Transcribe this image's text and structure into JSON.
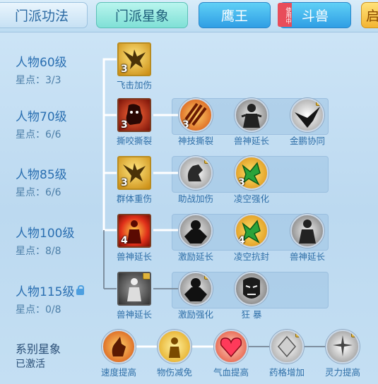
{
  "tabs": [
    {
      "label": "门派功法",
      "style": "plain"
    },
    {
      "label": "门派星象",
      "style": "active"
    },
    {
      "label": "鹰王",
      "style": "blue",
      "ribbon": "使用中"
    },
    {
      "label": "斗兽",
      "style": "blue"
    },
    {
      "label": "启",
      "style": "gold"
    }
  ],
  "tiers": [
    {
      "level": "人物60级",
      "stars": "星点：3/3",
      "locked": false
    },
    {
      "level": "人物70级",
      "stars": "星点：6/6",
      "locked": false
    },
    {
      "level": "人物85级",
      "stars": "星点：6/6",
      "locked": false
    },
    {
      "level": "人物100级",
      "stars": "星点：8/8",
      "locked": false
    },
    {
      "level": "人物115级",
      "stars": "星点：0/8",
      "locked": true
    }
  ],
  "skills": {
    "r1": [
      {
        "name": "飞击加伤",
        "level": "3",
        "icon": "eagle-icon",
        "shape": "square",
        "frame": "gold"
      }
    ],
    "r2": [
      {
        "name": "撕咬撕裂",
        "level": "3",
        "icon": "beast-icon",
        "shape": "square",
        "frame": "red"
      },
      {
        "name": "神技撕裂",
        "level": "3",
        "icon": "claw-slash-icon",
        "shape": "round"
      },
      {
        "name": "兽神延长",
        "level": "",
        "icon": "figure-icon",
        "shape": "round"
      },
      {
        "name": "金鹏协同",
        "level": "",
        "icon": "dark-eagle-icon",
        "shape": "round",
        "locked": true
      }
    ],
    "r3": [
      {
        "name": "群体重伤",
        "level": "3",
        "icon": "eagle-icon",
        "shape": "square",
        "frame": "gold"
      },
      {
        "name": "助战加伤",
        "level": "",
        "icon": "grab-hand-icon",
        "shape": "round",
        "locked": true
      },
      {
        "name": "凌空强化",
        "level": "3",
        "icon": "green-beast-icon",
        "shape": "round"
      }
    ],
    "r4": [
      {
        "name": "兽神延长",
        "level": "4",
        "icon": "figure-icon",
        "shape": "square",
        "frame": "red"
      },
      {
        "name": "激励延长",
        "level": "",
        "icon": "dark-figure-icon",
        "shape": "round"
      },
      {
        "name": "凌空抗封",
        "level": "4",
        "icon": "green-beast-icon",
        "shape": "round"
      },
      {
        "name": "兽神延长",
        "level": "",
        "icon": "figure-icon",
        "shape": "round"
      }
    ],
    "r5": [
      {
        "name": "兽神延长",
        "level": "",
        "icon": "figure-icon",
        "shape": "square",
        "frame": "grey",
        "locked": true
      },
      {
        "name": "激励强化",
        "level": "",
        "icon": "dark-figure-icon",
        "shape": "round",
        "locked": true
      },
      {
        "name": "狂 暴",
        "level": "",
        "icon": "rage-face-icon",
        "shape": "round"
      }
    ]
  },
  "series": {
    "title": "系别星象",
    "status": "已激活",
    "items": [
      {
        "name": "速度提高",
        "icon": "hand-flame-icon",
        "locked": false
      },
      {
        "name": "物伤减免",
        "icon": "golden-figure-icon",
        "locked": false
      },
      {
        "name": "气血提高",
        "icon": "heart-icon",
        "locked": false
      },
      {
        "name": "药格增加",
        "icon": "crystal-icon",
        "locked": true
      },
      {
        "name": "灵力提高",
        "icon": "sparkle-hand-icon",
        "locked": true
      }
    ]
  },
  "colors": {
    "accent": "#2b6aa3",
    "line": "#ffffff"
  }
}
